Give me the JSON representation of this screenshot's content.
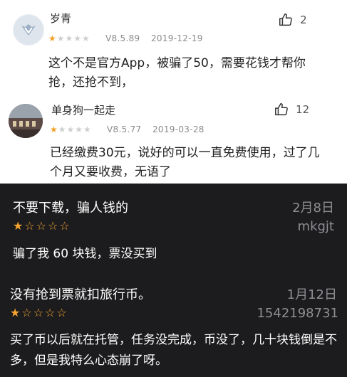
{
  "reviews_light": [
    {
      "user": "岁青",
      "rating": 1,
      "rating_stars": "★☆☆☆☆",
      "version": "V8.5.89",
      "date": "2019-12-19",
      "likes": "2",
      "text": "这个不是官方App，被骗了50，需要花钱才帮你抢，还抢不到，"
    },
    {
      "user": "单身狗一起走",
      "rating": 1,
      "rating_stars": "★☆☆☆☆",
      "version": "V8.5.77",
      "date": "2019-03-28",
      "likes": "12",
      "text": "已经缴费30元，说好的可以一直免费使用，过了几个月又要收费，无语了"
    }
  ],
  "reviews_dark": [
    {
      "title": "不要下载，骗人钱的",
      "date": "2月8日",
      "rating": 1,
      "rating_stars": "★☆☆☆☆",
      "author": "mkgjt",
      "text": "骗了我 60 块钱，票没买到"
    },
    {
      "title": "没有抢到票就扣旅行币。",
      "date": "1月12日",
      "rating": 1,
      "rating_stars": "★☆☆☆☆",
      "author": "1542198731",
      "text": "买了币以后就在托管，任务没完成，币没了，几十块钱倒是不多，但是我特么心态崩了呀。"
    }
  ],
  "icons": {
    "like": "thumbs-up-icon"
  },
  "colors": {
    "star_light": "#f2a024",
    "star_dark": "#f7a530",
    "dark_bg": "#1c1c1e"
  }
}
